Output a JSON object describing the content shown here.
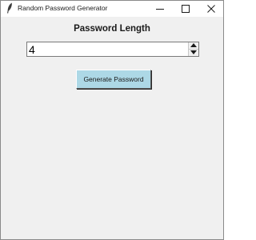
{
  "window": {
    "title": "Random Password Generator",
    "icon": "feather-icon",
    "controls": {
      "minimize_icon": "minimize-icon",
      "maximize_icon": "maximize-icon",
      "close_icon": "close-icon"
    }
  },
  "form": {
    "heading": "Password Length",
    "length_value": "4",
    "spin_up_icon": "arrow-up-icon",
    "spin_down_icon": "arrow-down-icon",
    "generate_label": "Generate Password"
  },
  "colors": {
    "button_background": "#add8e6",
    "window_background": "#f0f0f0"
  }
}
